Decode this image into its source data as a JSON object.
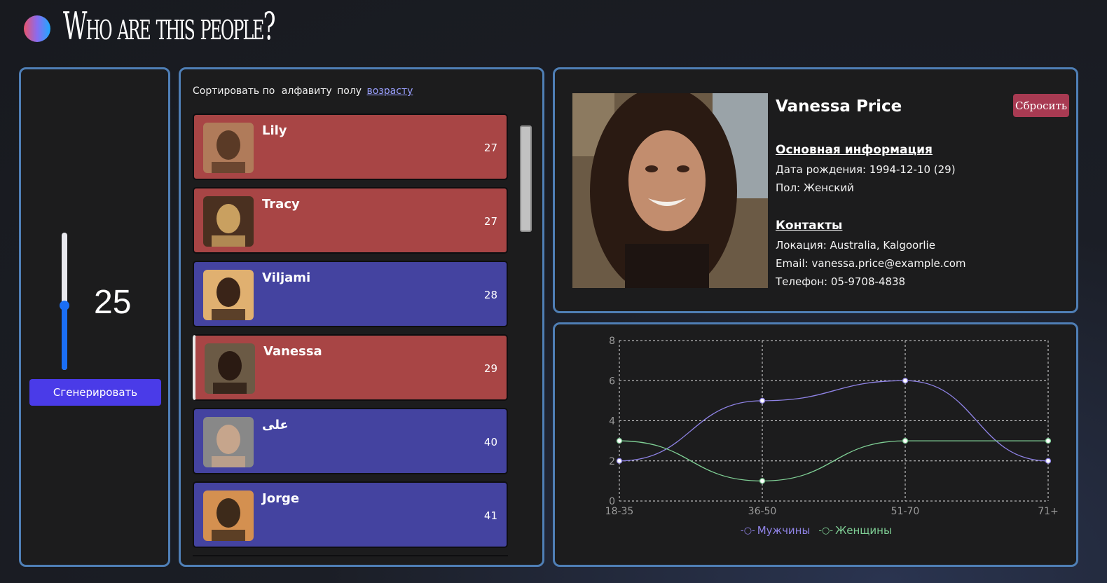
{
  "header": {
    "title": "Who are this people?"
  },
  "generator": {
    "count": "25",
    "slider_fraction": 0.47,
    "button_label": "Сгенерировать"
  },
  "list": {
    "sort_label": "Сортировать по",
    "sort_options": [
      "алфавиту",
      "полу",
      "возрасту"
    ],
    "active_sort": "возрасту",
    "people": [
      {
        "name": "Lily",
        "age": "27",
        "gender": "female",
        "selected": false
      },
      {
        "name": "Tracy",
        "age": "27",
        "gender": "female",
        "selected": false
      },
      {
        "name": "Viljami",
        "age": "28",
        "gender": "male",
        "selected": false
      },
      {
        "name": "Vanessa",
        "age": "29",
        "gender": "female",
        "selected": true
      },
      {
        "name": "علی",
        "age": "40",
        "gender": "male",
        "selected": false
      },
      {
        "name": "Jorge",
        "age": "41",
        "gender": "male",
        "selected": false
      }
    ]
  },
  "profile": {
    "name": "Vanessa Price",
    "reset_label": "Сбросить",
    "basic_heading": "Основная информация",
    "birth": "Дата рождения: 1994-12-10 (29)",
    "gender": "Пол: Женский",
    "contacts_heading": "Контакты",
    "location": "Локация: Australia, Kalgoorlie",
    "email": "Email: vanessa.price@example.com",
    "phone": "Телефон: 05-9708-4838"
  },
  "colors": {
    "female_card": "#a84545",
    "male_card": "#4443a0",
    "accent": "#4a3be8",
    "panel_border": "#4f7fb6",
    "series_men": "#8f83e6",
    "series_women": "#7fcf95"
  },
  "chart_data": {
    "type": "line",
    "categories": [
      "18-35",
      "36-50",
      "51-70",
      "71+"
    ],
    "y_ticks": [
      "0",
      "2",
      "4",
      "6",
      "8"
    ],
    "ylim": [
      0,
      8
    ],
    "grid": true,
    "legend_position": "bottom",
    "series": [
      {
        "name": "Мужчины",
        "values": [
          2,
          5,
          6,
          2
        ]
      },
      {
        "name": "Женщины",
        "values": [
          3,
          1,
          3,
          3
        ]
      }
    ]
  }
}
